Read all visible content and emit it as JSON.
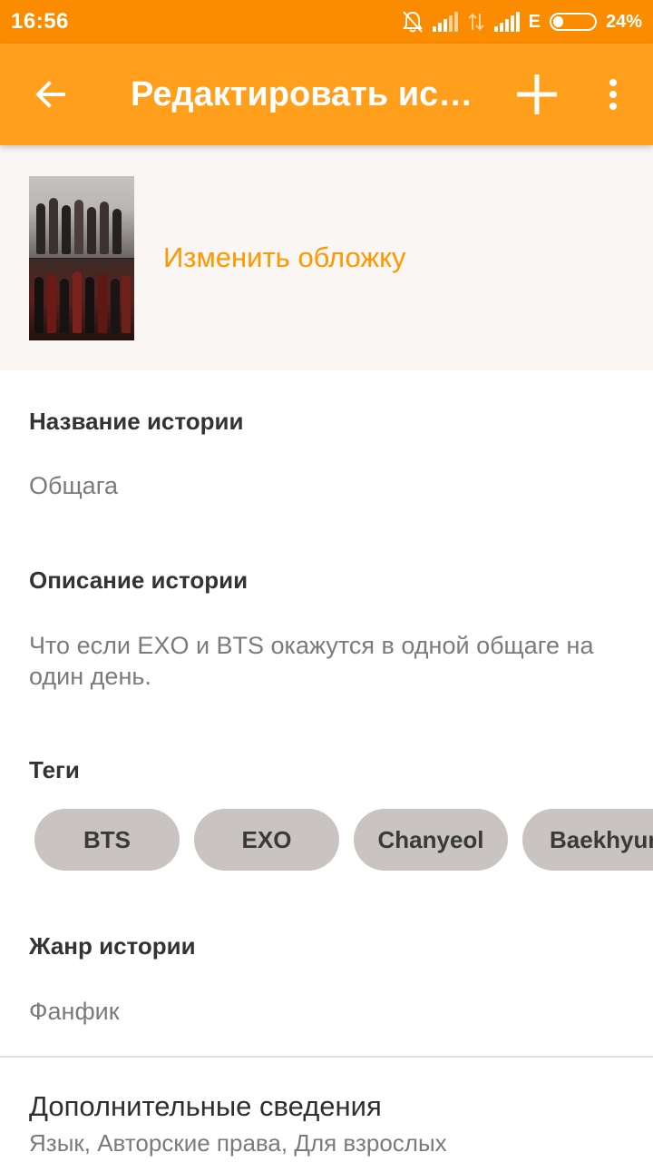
{
  "status_bar": {
    "time": "16:56",
    "network_letter": "E",
    "battery": "24%",
    "battery_level": 0.24
  },
  "app_bar": {
    "title": "Редактировать ис…",
    "color": "#ff9f1c"
  },
  "cover": {
    "change_label": "Изменить обложку"
  },
  "story_name": {
    "label": "Название истории",
    "value": "Общага"
  },
  "story_description": {
    "label": "Описание истории",
    "value": "Что если EXO и BTS   окажутся в одной общаге на один день."
  },
  "tags": {
    "label": "Теги",
    "items": [
      "BTS",
      "EXO",
      "Chanyeol",
      "Baekhyun"
    ]
  },
  "genre": {
    "label": "Жанр истории",
    "value": "Фанфик"
  },
  "extra": {
    "title": "Дополнительные сведения",
    "subtitle": "Язык, Авторские права, Для взрослых"
  },
  "colors": {
    "accent": "#ff9800",
    "status_bar": "#fb8c00",
    "tag_bg": "#c9c4c2"
  },
  "icons": [
    "back-arrow-icon",
    "plus-icon",
    "more-vert-icon",
    "alarm-off-icon",
    "signal-icon",
    "data-arrows-icon",
    "battery-icon"
  ]
}
